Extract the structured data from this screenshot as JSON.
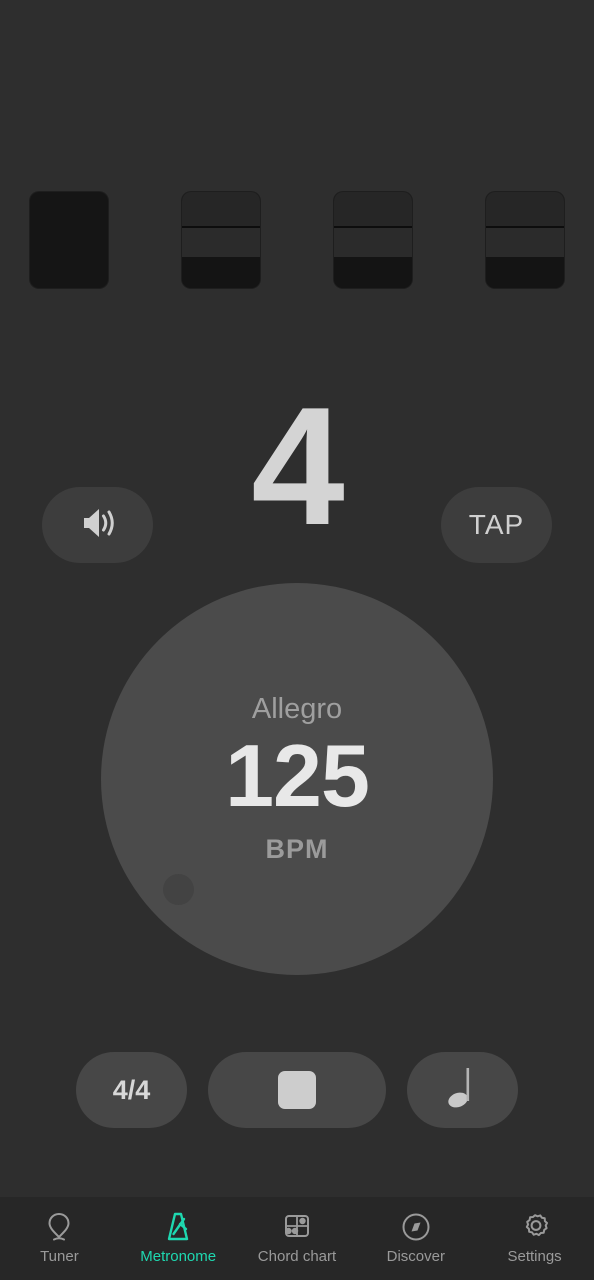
{
  "theme": {
    "background": "#2e2e2e",
    "accent": "#1ed8b0",
    "dial_color": "#4b4b4b",
    "button_color": "#474747",
    "text_primary": "#e8e8e8",
    "text_secondary": "#9a9a9a"
  },
  "beats": {
    "count": 4,
    "current": 1,
    "items": [
      {
        "index": 1,
        "state": "active"
      },
      {
        "index": 2,
        "state": "inactive"
      },
      {
        "index": 3,
        "state": "inactive"
      },
      {
        "index": 4,
        "state": "inactive"
      }
    ]
  },
  "beat_display": {
    "value": "4"
  },
  "sound_button": {
    "icon": "speaker-volume-icon"
  },
  "tap_button": {
    "label": "TAP"
  },
  "dial": {
    "tempo_marking": "Allegro",
    "bpm_value": "125",
    "bpm_unit": "BPM",
    "knob": "dial-knob"
  },
  "controls": {
    "time_signature": "4/4",
    "play_state": "playing",
    "play_icon": "stop-square-icon",
    "note_value_icon": "quarter-note-icon"
  },
  "navbar": {
    "active_index": 1,
    "items": [
      {
        "label": "Tuner",
        "icon": "tuning-fork-pin-icon",
        "active": false
      },
      {
        "label": "Metronome",
        "icon": "metronome-icon",
        "active": true
      },
      {
        "label": "Chord chart",
        "icon": "chord-grid-icon",
        "active": false
      },
      {
        "label": "Discover",
        "icon": "compass-icon",
        "active": false
      },
      {
        "label": "Settings",
        "icon": "gear-icon",
        "active": false
      }
    ]
  }
}
